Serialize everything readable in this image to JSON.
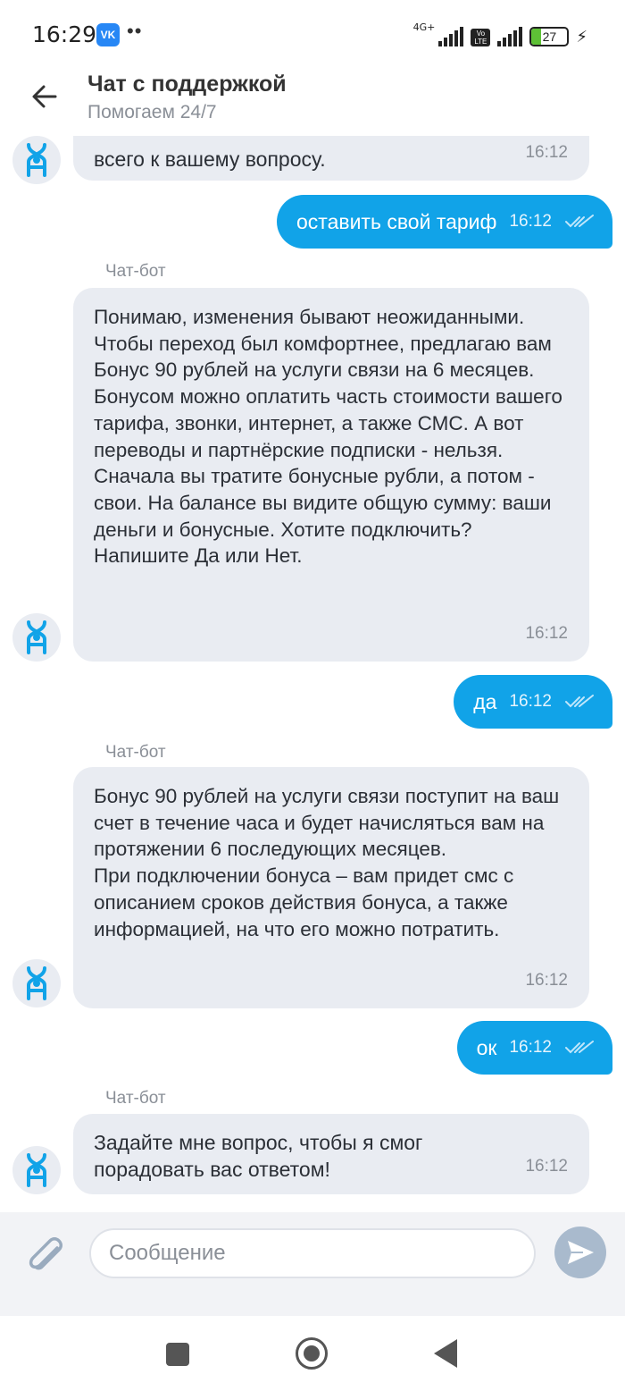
{
  "status_bar": {
    "time": "16:29",
    "vk_label": "VK",
    "network_label": "4G+",
    "volte_label": "Vo LTE",
    "battery_level": "27",
    "battery_fraction": 0.27
  },
  "header": {
    "title": "Чат с поддержкой",
    "subtitle": "Помогаем 24/7"
  },
  "messages": [
    {
      "type": "bot",
      "text": "всего к вашему вопросу.",
      "time": "16:12"
    },
    {
      "type": "user",
      "text": "оставить свой тариф",
      "time": "16:12"
    },
    {
      "type": "bot",
      "sender": "Чат-бот",
      "text": "Понимаю, изменения бывают неожиданными. Чтобы переход был комфортнее, предлагаю вам Бонус 90 рублей на услуги связи на 6 месяцев. Бонусом можно оплатить часть стоимости вашего тарифа, звонки, интернет, а также СМС. А вот переводы и партнёрские подписки - нельзя.\nСначала вы тратите бонусные рубли, а потом - свои. На балансе вы видите общую сумму: ваши деньги и бонусные. Хотите подключить? Напишите Да или Нет.",
      "time": "16:12"
    },
    {
      "type": "user",
      "text": "да",
      "time": "16:12"
    },
    {
      "type": "bot",
      "sender": "Чат-бот",
      "text": "Бонус 90 рублей на услуги связи поступит на ваш счет в течение часа и будет начисляться вам на протяжении 6 последующих месяцев.\nПри подключении бонуса – вам придет смс с описанием сроков действия бонуса, а также информацией, на что его можно потратить.",
      "time": "16:12"
    },
    {
      "type": "user",
      "text": "ок",
      "time": "16:12"
    },
    {
      "type": "bot",
      "sender": "Чат-бот",
      "text": "Задайте мне вопрос, чтобы я смог порадовать вас ответом!",
      "time": "16:12"
    }
  ],
  "input": {
    "placeholder": "Сообщение"
  },
  "colors": {
    "accent": "#11a3e8",
    "bot_bubble": "#e9ecf2",
    "send_button": "#a9bacd"
  }
}
